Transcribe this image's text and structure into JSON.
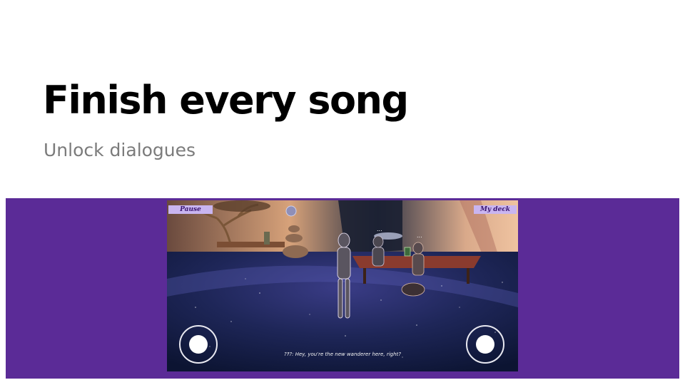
{
  "slide": {
    "title": "Finish every song",
    "subtitle": "Unlock dialogues"
  },
  "game": {
    "pause_label": "Pause",
    "deck_label": "My deck",
    "dialogue_text": "???: Hey, you're the new wanderer here, right?",
    "speech_indicators": [
      "...",
      "..."
    ]
  },
  "colors": {
    "band": "#5b2b97",
    "hud_button": "#c9b5f0",
    "floor": "#1a2350"
  },
  "icons": [
    "moon-icon",
    "left-joystick-icon",
    "right-joystick-icon"
  ]
}
